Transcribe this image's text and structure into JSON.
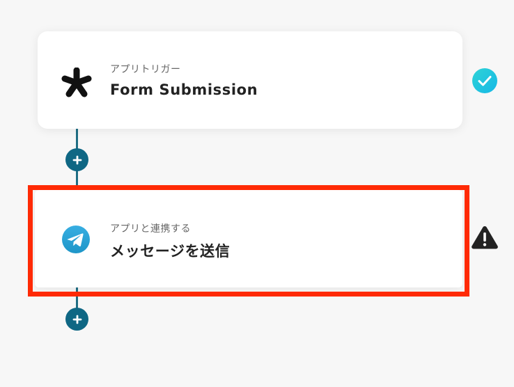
{
  "flow": {
    "steps": [
      {
        "type_label": "アプリトリガー",
        "title": "Form Submission",
        "icon": "asterisk-icon",
        "status": "success"
      },
      {
        "type_label": "アプリと連携する",
        "title": "メッセージを送信",
        "icon": "telegram-icon",
        "status": "warning"
      }
    ]
  },
  "colors": {
    "connector": "#1f6e84",
    "add_button": "#0f6784",
    "highlight": "#ff2a05",
    "success": "#1fc6e0",
    "warning": "#222222",
    "telegram": "#2aa0e0"
  }
}
